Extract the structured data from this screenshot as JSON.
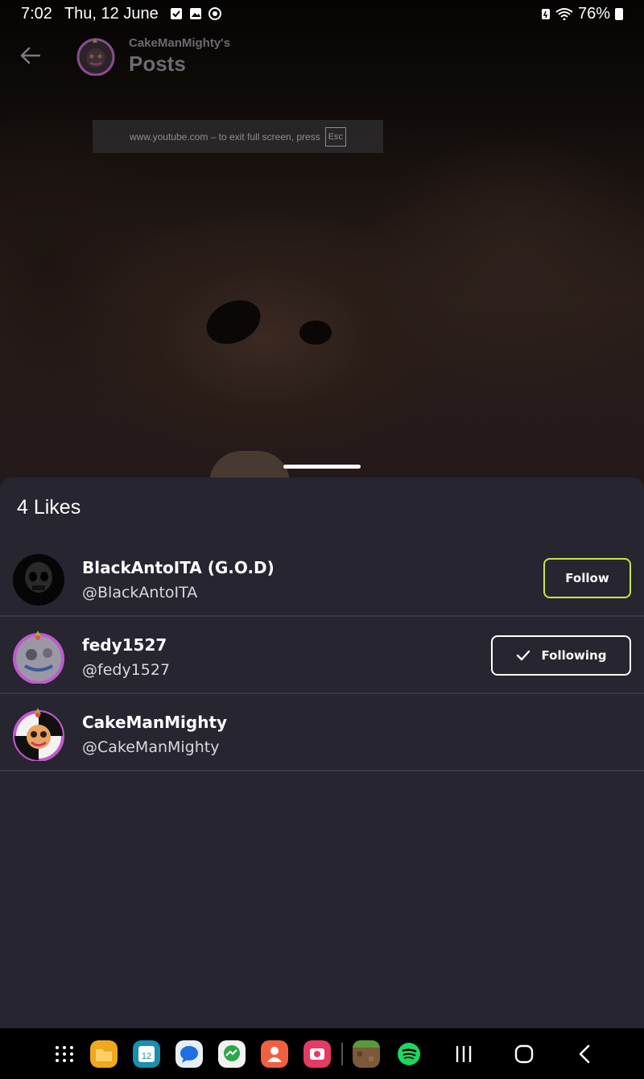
{
  "status_bar": {
    "time": "7:02",
    "date": "Thu, 12 June",
    "battery": "76%"
  },
  "fullscreen_notice": {
    "text": "www.youtube.com – to exit full screen, press",
    "key": "Esc"
  },
  "header": {
    "owner": "CakeManMighty's",
    "title": "Posts"
  },
  "likes_sheet": {
    "title": "4 Likes",
    "users": [
      {
        "name": "BlackAntoITA (G.O.D)",
        "handle": "@BlackAntoITA",
        "action": "Follow"
      },
      {
        "name": "fedy1527",
        "handle": "@fedy1527",
        "action": "Following"
      },
      {
        "name": "CakeManMighty",
        "handle": "@CakeManMighty",
        "action": ""
      }
    ]
  },
  "colors": {
    "sheet_bg": "#27252f",
    "follow_border": "#c4e84a",
    "divider": "#3a3843",
    "avatar_ring": "#c05ad0"
  },
  "dock": {
    "apps": [
      "app-drawer",
      "my-files",
      "calendar",
      "messages",
      "messenger",
      "contacts",
      "screen-recorder",
      "minecraft",
      "spotify"
    ],
    "nav": [
      "recents",
      "home",
      "back"
    ]
  }
}
